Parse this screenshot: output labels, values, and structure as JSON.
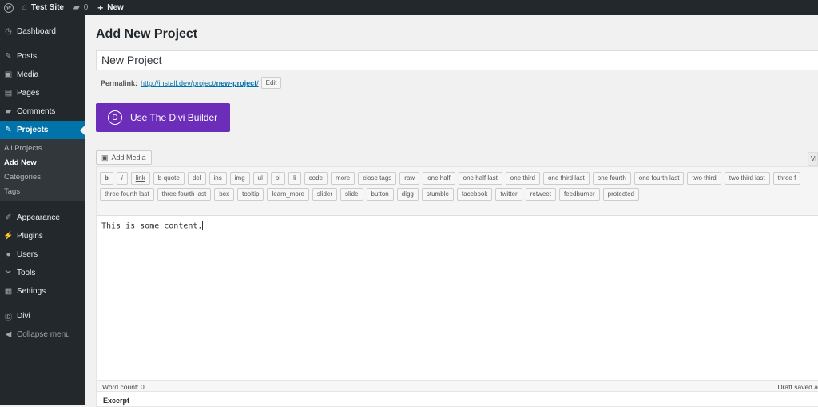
{
  "adminbar": {
    "site_name": "Test Site",
    "comments_count": "0",
    "new_label": "New"
  },
  "sidebar": {
    "items": [
      {
        "label": "Dashboard",
        "icon": "dashboard-icon"
      },
      {
        "label": "Posts",
        "icon": "pin-icon"
      },
      {
        "label": "Media",
        "icon": "media-icon"
      },
      {
        "label": "Pages",
        "icon": "pages-icon"
      },
      {
        "label": "Comments",
        "icon": "comment-icon"
      },
      {
        "label": "Projects",
        "icon": "pin-icon"
      }
    ],
    "submenu": [
      "All Projects",
      "Add New",
      "Categories",
      "Tags"
    ],
    "items2": [
      {
        "label": "Appearance",
        "icon": "brush-icon"
      },
      {
        "label": "Plugins",
        "icon": "plug-icon"
      },
      {
        "label": "Users",
        "icon": "user-icon"
      },
      {
        "label": "Tools",
        "icon": "wrench-icon"
      },
      {
        "label": "Settings",
        "icon": "settings-icon"
      }
    ],
    "divi": "Divi",
    "collapse": "Collapse menu"
  },
  "page": {
    "title": "Add New Project",
    "post_title_value": "New Project",
    "permalink_label": "Permalink:",
    "permalink_url_base": "http://install.dev/project/",
    "permalink_slug": "new-project",
    "permalink_trailing": "/",
    "edit_label": "Edit",
    "divi_button": "Use The Divi Builder",
    "add_media": "Add Media",
    "visual_tab": "Vi"
  },
  "toolbar": {
    "row1": [
      "b",
      "i",
      "link",
      "b-quote",
      "del",
      "ins",
      "img",
      "ul",
      "ol",
      "li",
      "code",
      "more",
      "close tags",
      "raw",
      "one half",
      "one half last",
      "one third",
      "one third last",
      "one fourth",
      "one fourth last",
      "two third",
      "two third last",
      "three f"
    ],
    "row2": [
      "three fourth last",
      "three fourth last",
      "box",
      "tooltip",
      "learn_more",
      "slider",
      "slide",
      "button",
      "digg",
      "stumble",
      "facebook",
      "twitter",
      "retweet",
      "feedburner",
      "protected"
    ]
  },
  "editor": {
    "content": "This is some content.",
    "word_count": "Word count: 0",
    "draft_saved": "Draft saved a"
  },
  "excerpt_title": "Excerpt",
  "colors": {
    "admin_bg": "#23282d",
    "active": "#0073aa",
    "divi_purple": "#6c2eb9"
  }
}
